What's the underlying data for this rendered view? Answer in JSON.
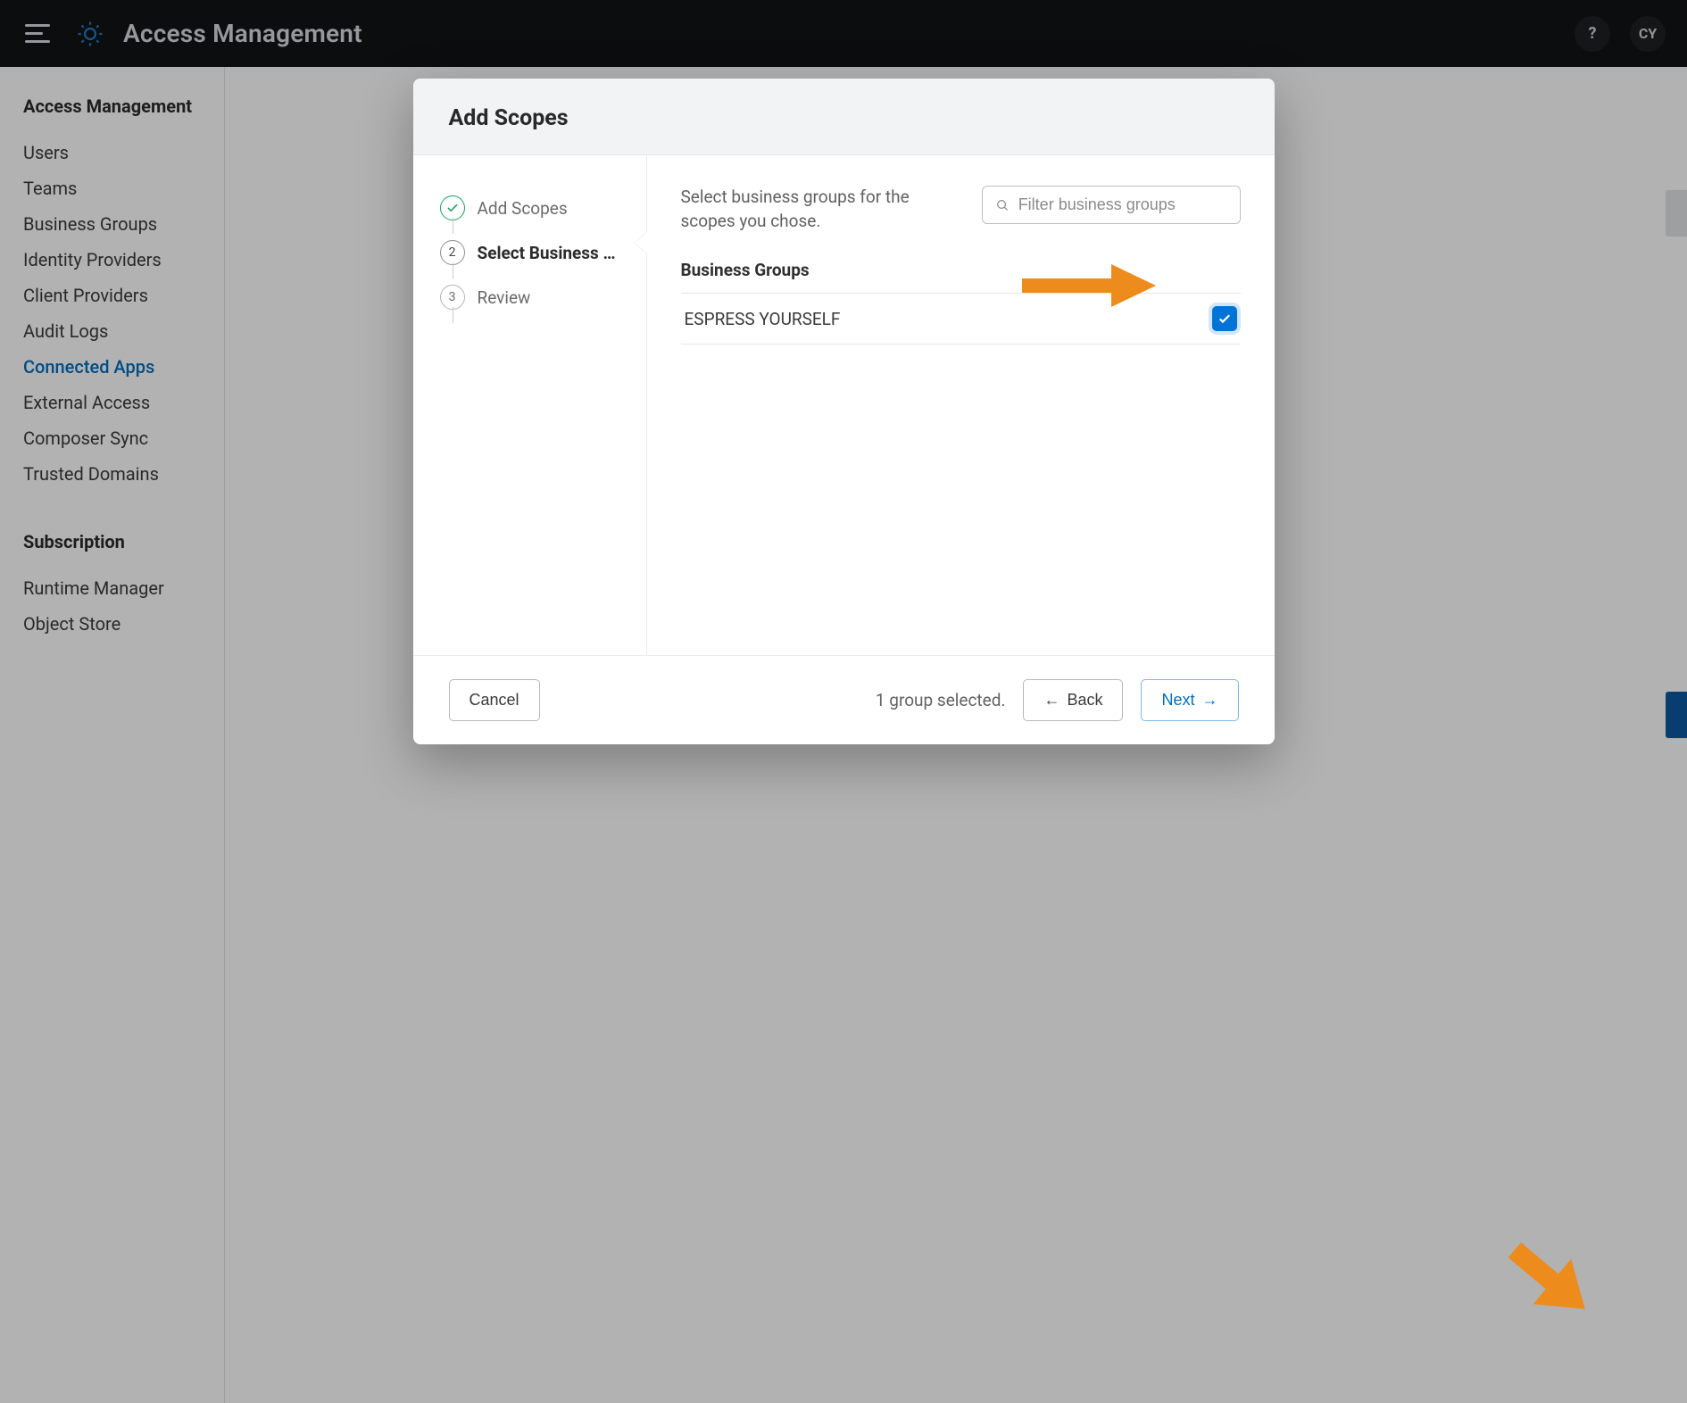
{
  "header": {
    "app_title": "Access Management",
    "help_label": "?",
    "avatar_initials": "CY"
  },
  "sidebar": {
    "section1_title": "Access Management",
    "items1": [
      {
        "label": "Users",
        "active": false
      },
      {
        "label": "Teams",
        "active": false
      },
      {
        "label": "Business Groups",
        "active": false
      },
      {
        "label": "Identity Providers",
        "active": false
      },
      {
        "label": "Client Providers",
        "active": false
      },
      {
        "label": "Audit Logs",
        "active": false
      },
      {
        "label": "Connected Apps",
        "active": true
      },
      {
        "label": "External Access",
        "active": false
      },
      {
        "label": "Composer Sync",
        "active": false
      },
      {
        "label": "Trusted Domains",
        "active": false
      }
    ],
    "section2_title": "Subscription",
    "items2": [
      {
        "label": "Runtime Manager",
        "active": false
      },
      {
        "label": "Object Store",
        "active": false
      }
    ]
  },
  "modal": {
    "title": "Add Scopes",
    "steps": [
      {
        "label": "Add Scopes",
        "state": "done"
      },
      {
        "label": "Select Business …",
        "state": "active",
        "num": "2"
      },
      {
        "label": "Review",
        "state": "pending",
        "num": "3"
      }
    ],
    "prompt": "Select business groups for the scopes you chose.",
    "search_placeholder": "Filter business groups",
    "groups_heading": "Business Groups",
    "groups": [
      {
        "name": "ESPRESS YOURSELF",
        "checked": true
      }
    ],
    "footer": {
      "cancel": "Cancel",
      "selected_text": "1 group selected.",
      "back": "Back",
      "next": "Next"
    }
  },
  "colors": {
    "accent_blue": "#0073d6",
    "arrow_orange": "#ed8b1c"
  }
}
